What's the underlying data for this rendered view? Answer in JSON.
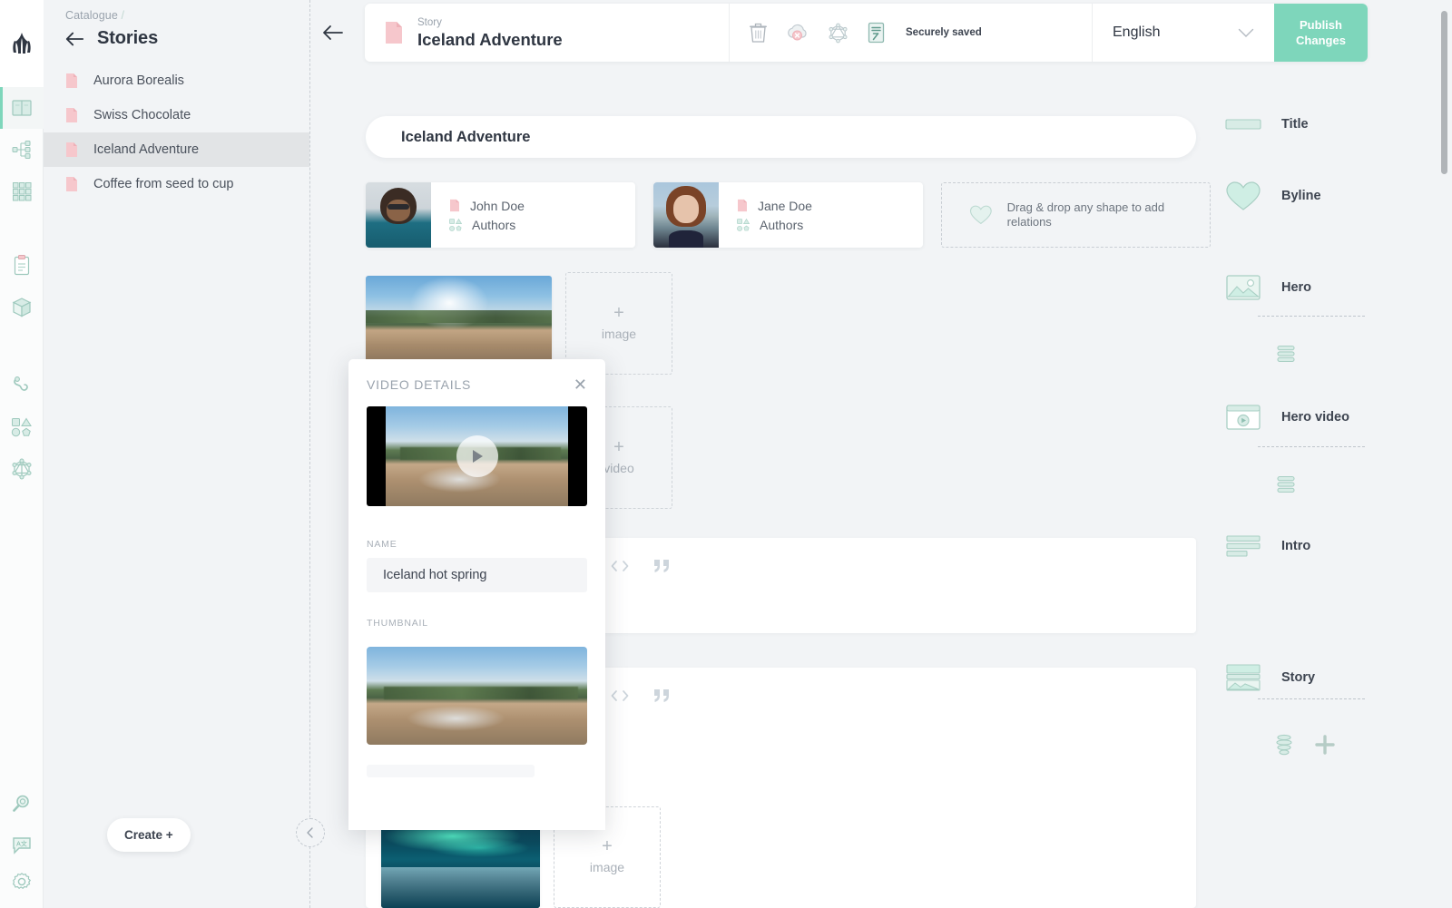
{
  "brand": {
    "accent": "#7ed6bb",
    "accent_soft": "#cfeee4",
    "pink": "#f6c7cc",
    "canvas_bg": "#f2f4f6"
  },
  "rail": {
    "logo_name": "app-logo",
    "items": [
      {
        "name": "catalogue-icon",
        "active": true
      },
      {
        "name": "sitemap-icon",
        "active": false
      },
      {
        "name": "grid-icon",
        "active": false
      },
      {
        "name": "forms-icon",
        "active": false
      },
      {
        "name": "box-icon",
        "active": false
      },
      {
        "name": "webhooks-icon",
        "active": false
      },
      {
        "name": "shapes-icon",
        "active": false
      },
      {
        "name": "graphql-icon",
        "active": false
      }
    ],
    "bottom_items": [
      {
        "name": "search-icon"
      },
      {
        "name": "translate-icon"
      },
      {
        "name": "settings-icon"
      }
    ]
  },
  "sidebar": {
    "breadcrumb": "Catalogue",
    "breadcrumb_separator": "/",
    "title": "Stories",
    "back_icon": "back-arrow-icon",
    "items": [
      {
        "label": "Aurora Borealis",
        "selected": false
      },
      {
        "label": "Swiss Chocolate",
        "selected": false
      },
      {
        "label": "Iceland Adventure",
        "selected": true
      },
      {
        "label": "Coffee from seed to cup",
        "selected": false
      }
    ],
    "create_button": "Create +"
  },
  "topbar": {
    "kicker": "Story",
    "title": "Iceland Adventure",
    "doc_icon": "document-icon",
    "tools": [
      {
        "name": "trash-icon"
      },
      {
        "name": "cloud-unpublish-icon"
      },
      {
        "name": "graphql-icon"
      },
      {
        "name": "preview-icon"
      }
    ],
    "status": "Securely saved",
    "language": "English",
    "language_caret": "chevron-down-icon",
    "publish_line1": "Publish",
    "publish_line2": "Changes"
  },
  "canvas": {
    "title_value": "Iceland Adventure",
    "authors": [
      {
        "name": "John Doe",
        "type": "Authors",
        "avatar": "man-portrait"
      },
      {
        "name": "Jane Doe",
        "type": "Authors",
        "avatar": "woman-portrait"
      }
    ],
    "relation_dropzone": "Drag & drop any shape to add relations",
    "dropzones": [
      {
        "key": "hero-image",
        "label": "image",
        "plus": "+"
      },
      {
        "key": "hero-video",
        "label": "video",
        "plus": "+"
      },
      {
        "key": "story-image",
        "label": "image",
        "plus": "+"
      }
    ],
    "media": [
      {
        "key": "hero-photo",
        "alt": "geyser-photo"
      },
      {
        "key": "story-photo",
        "alt": "aurora-photo"
      }
    ]
  },
  "schema": {
    "fields": [
      {
        "label": "Title",
        "icon": "title-field-icon"
      },
      {
        "label": "Byline",
        "icon": "heart-relation-icon"
      },
      {
        "label": "Hero",
        "icon": "image-field-icon"
      },
      {
        "label": "Hero video",
        "icon": "video-field-icon"
      },
      {
        "label": "Intro",
        "icon": "richtext-field-icon"
      },
      {
        "label": "Story",
        "icon": "component-field-icon"
      }
    ],
    "add_icon": "plus-icon",
    "stack_icon": "stack-icon"
  },
  "modal": {
    "title": "VIDEO DETAILS",
    "close_icon": "close-icon",
    "play_icon": "play-icon",
    "name_label": "NAME",
    "name_value": "Iceland hot spring",
    "name_placeholder": "Name",
    "thumbnail_label": "THUMBNAIL",
    "thumbnail_alt": "iceland-hot-spring-thumbnail"
  }
}
